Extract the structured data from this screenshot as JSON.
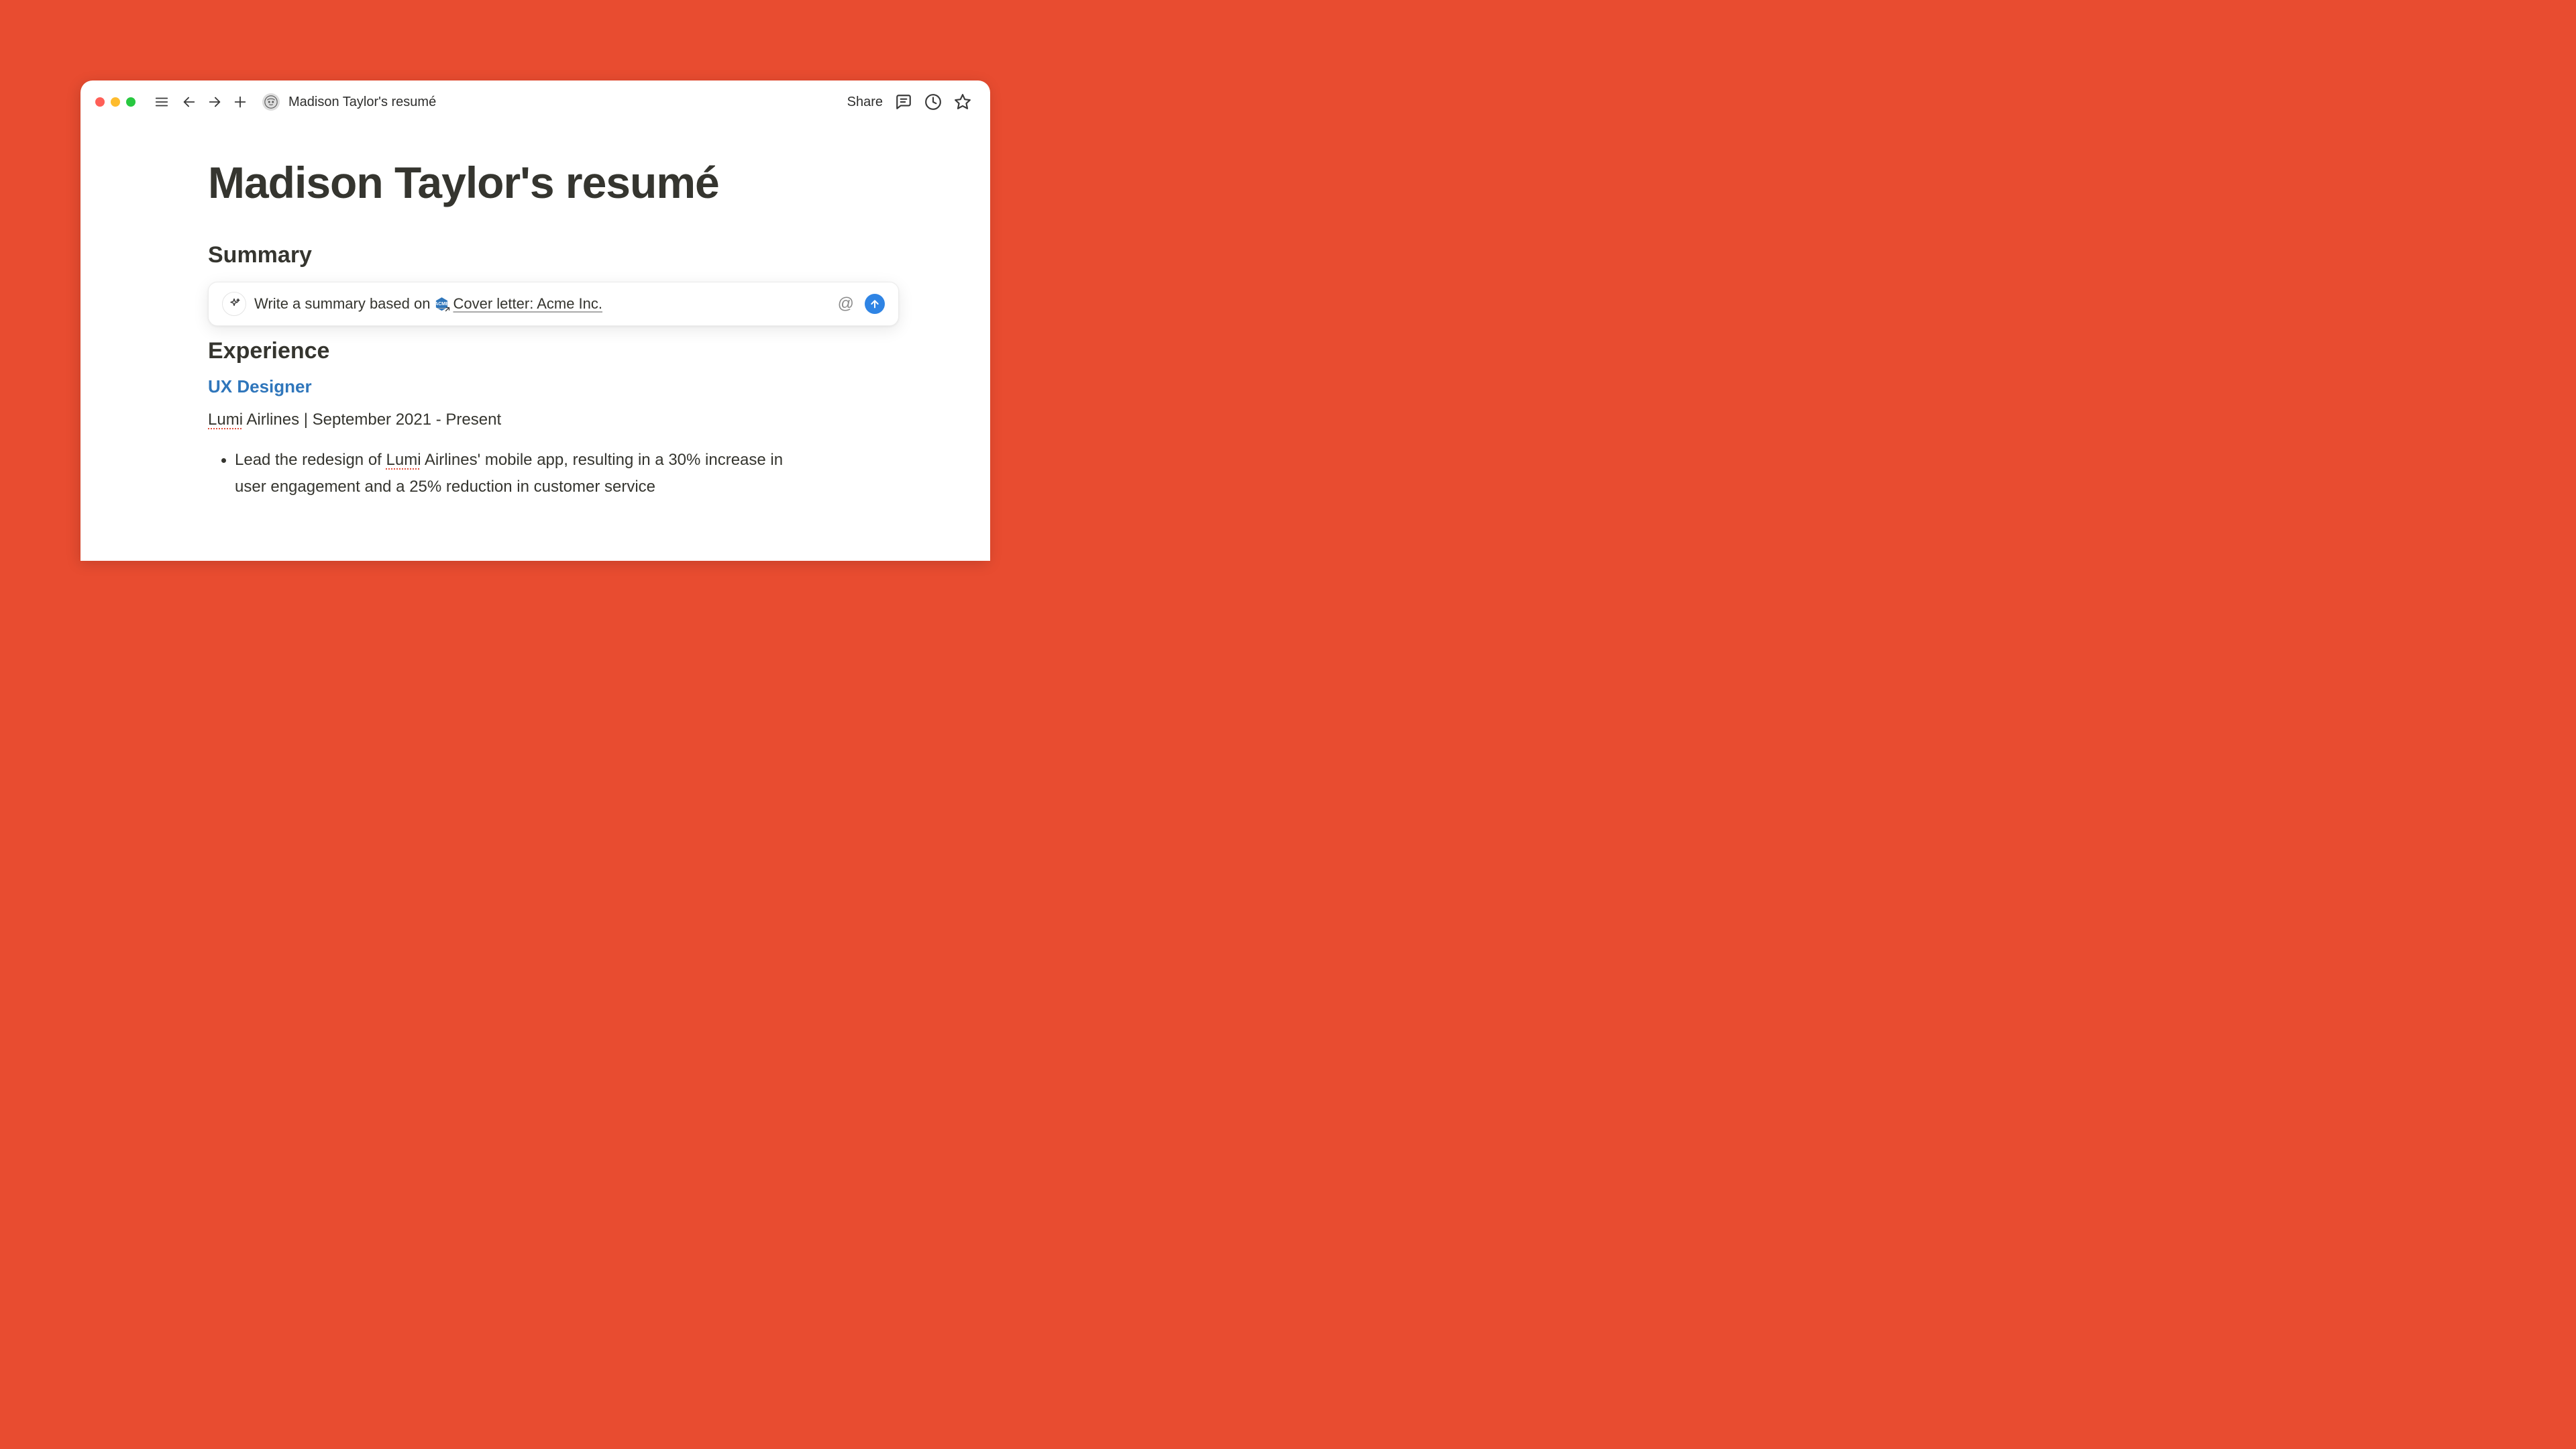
{
  "toolbar": {
    "page_title": "Madison Taylor's resumé",
    "share_label": "Share"
  },
  "document": {
    "title": "Madison Taylor's resumé",
    "summary_heading": "Summary",
    "experience_heading": "Experience"
  },
  "ai": {
    "prompt_prefix": "Write a summary based on",
    "mention_text": "Cover letter: Acme Inc.",
    "mention_badge": "ACME",
    "at_label": "@"
  },
  "job": {
    "title": "UX Designer",
    "company": "Lumi",
    "line_rest": " Airlines | September 2021 - Present",
    "bullet_prefix": "Lead the redesign of ",
    "bullet_company": "Lumi",
    "bullet_suffix": " Airlines' mobile app, resulting in a 30% increase in user engagement and a 25% reduction in customer service"
  }
}
